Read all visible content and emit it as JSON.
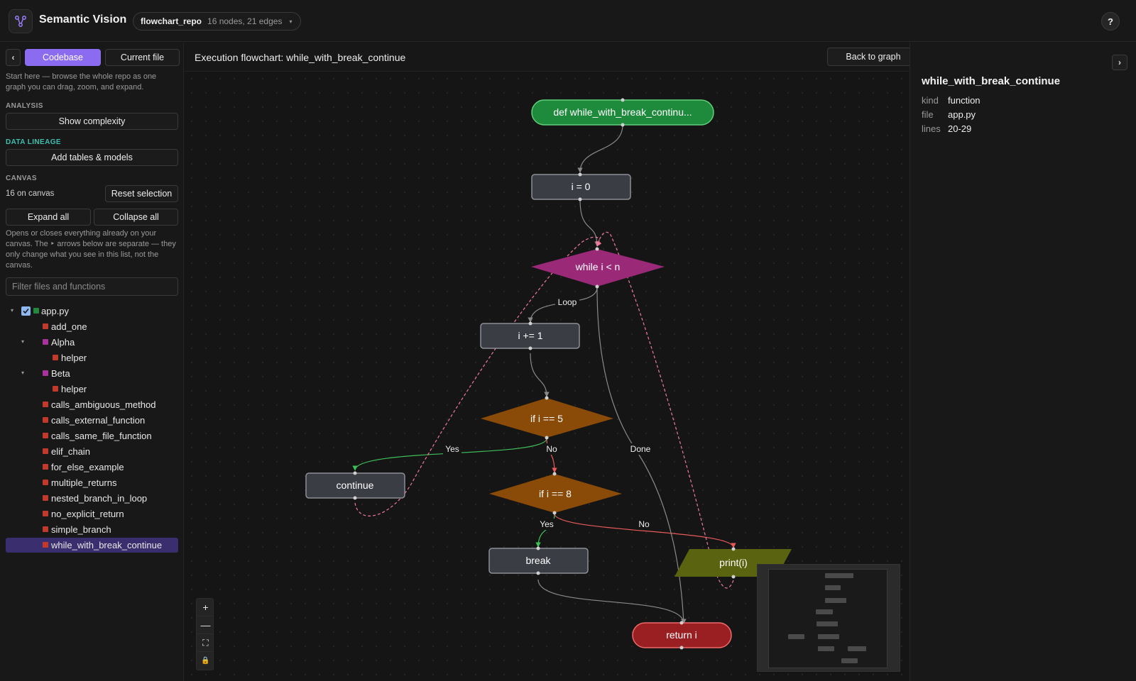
{
  "app": {
    "title": "Semantic Vision",
    "repo_name": "flowchart_repo",
    "repo_stats": "16 nodes, 21 edges",
    "help_label": "?"
  },
  "sidebar": {
    "collapse_label": "‹",
    "tabs": [
      "Codebase",
      "Current file"
    ],
    "active_tab": "Codebase",
    "intro": "Start here — browse the whole repo as one graph you can drag, zoom, and expand.",
    "analysis": {
      "label": "ANALYSIS",
      "button": "Show complexity"
    },
    "lineage": {
      "label": "DATA LINEAGE",
      "button": "Add tables & models"
    },
    "canvas": {
      "label": "CANVAS",
      "count": "16 on canvas",
      "reset": "Reset selection",
      "expand": "Expand all",
      "collapse": "Collapse all",
      "note": "Opens or closes everything already on your canvas. The ‣ arrows below are separate — they only change what you see in this list, not the canvas."
    },
    "filter_placeholder": "Filter files and functions",
    "tree": [
      {
        "label": "app.py",
        "level": 0,
        "kind": "file",
        "expanded": true,
        "checked": true,
        "color": "#1f8a3a"
      },
      {
        "label": "add_one",
        "level": 1,
        "kind": "function",
        "color": "#c0392b"
      },
      {
        "label": "Alpha",
        "level": 1,
        "kind": "class",
        "expanded": true,
        "color": "#a8339a"
      },
      {
        "label": "helper",
        "level": 2,
        "kind": "function",
        "color": "#c0392b"
      },
      {
        "label": "Beta",
        "level": 1,
        "kind": "class",
        "expanded": true,
        "color": "#a8339a"
      },
      {
        "label": "helper",
        "level": 2,
        "kind": "function",
        "color": "#c0392b"
      },
      {
        "label": "calls_ambiguous_method",
        "level": 1,
        "kind": "function",
        "color": "#c0392b"
      },
      {
        "label": "calls_external_function",
        "level": 1,
        "kind": "function",
        "color": "#c0392b"
      },
      {
        "label": "calls_same_file_function",
        "level": 1,
        "kind": "function",
        "color": "#c0392b"
      },
      {
        "label": "elif_chain",
        "level": 1,
        "kind": "function",
        "color": "#c0392b"
      },
      {
        "label": "for_else_example",
        "level": 1,
        "kind": "function",
        "color": "#c0392b"
      },
      {
        "label": "multiple_returns",
        "level": 1,
        "kind": "function",
        "color": "#c0392b"
      },
      {
        "label": "nested_branch_in_loop",
        "level": 1,
        "kind": "function",
        "color": "#c0392b"
      },
      {
        "label": "no_explicit_return",
        "level": 1,
        "kind": "function",
        "color": "#c0392b"
      },
      {
        "label": "simple_branch",
        "level": 1,
        "kind": "function",
        "color": "#c0392b"
      },
      {
        "label": "while_with_break_continue",
        "level": 1,
        "kind": "function",
        "color": "#c0392b",
        "selected": true
      }
    ]
  },
  "canvas": {
    "title": "Execution flowchart: while_with_break_continue",
    "back_label": "Back to graph",
    "zoom_controls": [
      "+",
      "—",
      "⛶",
      "🔒"
    ],
    "flowchart": {
      "nodes": [
        {
          "id": "start",
          "label": "def while_with_break_continu...",
          "kind": "terminal-start",
          "color": "#1e8a3c"
        },
        {
          "id": "init",
          "label": "i = 0",
          "kind": "process",
          "color": "#3b3d44"
        },
        {
          "id": "loop",
          "label": "while i < n",
          "kind": "decision",
          "color": "#9a2a78"
        },
        {
          "id": "inc",
          "label": "i += 1",
          "kind": "process",
          "color": "#3b3d44"
        },
        {
          "id": "if5",
          "label": "if i == 5",
          "kind": "decision",
          "color": "#8a4a08"
        },
        {
          "id": "cont",
          "label": "continue",
          "kind": "process",
          "color": "#3b3d44"
        },
        {
          "id": "if8",
          "label": "if i == 8",
          "kind": "decision",
          "color": "#8a4a08"
        },
        {
          "id": "brk",
          "label": "break",
          "kind": "process",
          "color": "#3b3d44"
        },
        {
          "id": "print",
          "label": "print(i)",
          "kind": "io",
          "color": "#5a6310"
        },
        {
          "id": "ret",
          "label": "return i",
          "kind": "terminal-end",
          "color": "#9a1f22"
        }
      ],
      "edge_labels": {
        "loop": "Loop",
        "yes5": "Yes",
        "no5": "No",
        "done": "Done",
        "yes8": "Yes",
        "no8": "No"
      }
    }
  },
  "details": {
    "toggle_label": "›",
    "title": "while_with_break_continue",
    "props": [
      {
        "key": "kind",
        "value": "function"
      },
      {
        "key": "file",
        "value": "app.py"
      },
      {
        "key": "lines",
        "value": "20-29"
      }
    ]
  },
  "colors": {
    "accent": "#8b6cf0",
    "teal": "#3fbfb0",
    "yes_edge": "#3fbf5a",
    "no_edge": "#e85a5a",
    "back_edge": "#f07a9a"
  }
}
